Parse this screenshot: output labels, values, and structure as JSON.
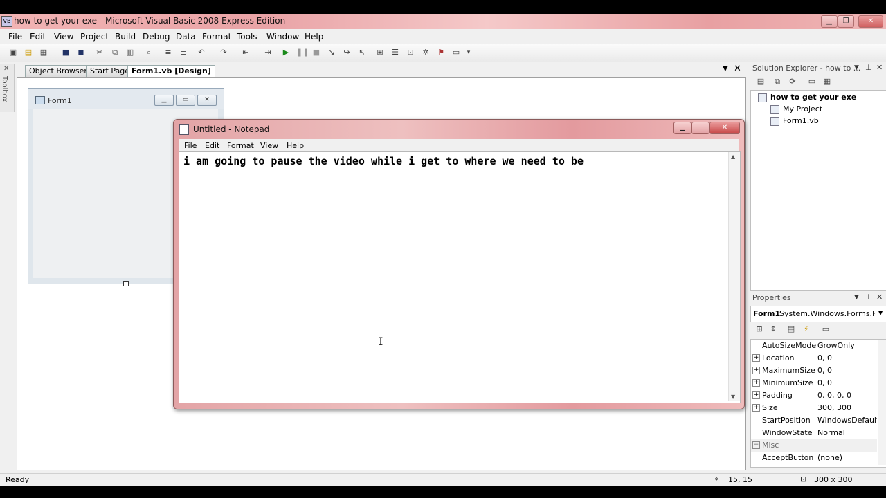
{
  "window": {
    "title": "how to get your exe - Microsoft Visual Basic 2008 Express Edition",
    "minimize": "▁",
    "maximize": "❐",
    "close": "✕"
  },
  "menu": [
    "File",
    "Edit",
    "View",
    "Project",
    "Build",
    "Debug",
    "Data",
    "Format",
    "Tools",
    "Window",
    "Help"
  ],
  "toolbar_icons": [
    "new-project-icon",
    "open-icon",
    "add-item-icon",
    "save-icon",
    "save-all-icon",
    "cut-icon",
    "copy-icon",
    "paste-icon",
    "find-icon",
    "comment-icon",
    "uncomment-icon",
    "undo-icon",
    "redo-icon",
    "navigate-back-icon",
    "navigate-forward-icon",
    "start-debug-icon",
    "pause-icon",
    "stop-icon",
    "step-into-icon",
    "step-over-icon",
    "step-out-icon",
    "solution-explorer-icon",
    "properties-icon",
    "object-browser-icon",
    "toolbox-icon",
    "error-list-icon"
  ],
  "toolbox": {
    "label": "Toolbox"
  },
  "tabs": [
    {
      "label": "Object Browser"
    },
    {
      "label": "Start Page"
    },
    {
      "label": "Form1.vb [Design]"
    }
  ],
  "form1": {
    "title": "Form1"
  },
  "notepad": {
    "title": "Untitled - Notepad",
    "menu": [
      "File",
      "Edit",
      "Format",
      "View",
      "Help"
    ],
    "text": "i am going to pause the video while i get to where we need to be"
  },
  "solution_explorer": {
    "title": "Solution Explorer - how to ...",
    "items": [
      {
        "label": "how to get your exe"
      },
      {
        "label": "My Project"
      },
      {
        "label": "Form1.vb"
      }
    ]
  },
  "properties": {
    "title": "Properties",
    "object_name": "Form1",
    "object_type": "System.Windows.Forms.For",
    "rows": [
      {
        "name": "AutoSizeMode",
        "value": "GrowOnly",
        "expand": ""
      },
      {
        "name": "Location",
        "value": "0, 0",
        "expand": "+"
      },
      {
        "name": "MaximumSize",
        "value": "0, 0",
        "expand": "+"
      },
      {
        "name": "MinimumSize",
        "value": "0, 0",
        "expand": "+"
      },
      {
        "name": "Padding",
        "value": "0, 0, 0, 0",
        "expand": "+"
      },
      {
        "name": "Size",
        "value": "300, 300",
        "expand": "+"
      },
      {
        "name": "StartPosition",
        "value": "WindowsDefault",
        "expand": ""
      },
      {
        "name": "WindowState",
        "value": "Normal",
        "expand": ""
      },
      {
        "name": "Misc",
        "value": "",
        "expand": "−"
      },
      {
        "name": "AcceptButton",
        "value": "(none)",
        "expand": ""
      }
    ]
  },
  "status": {
    "text": "Ready",
    "position": "15, 15",
    "size": "300 x 300"
  }
}
